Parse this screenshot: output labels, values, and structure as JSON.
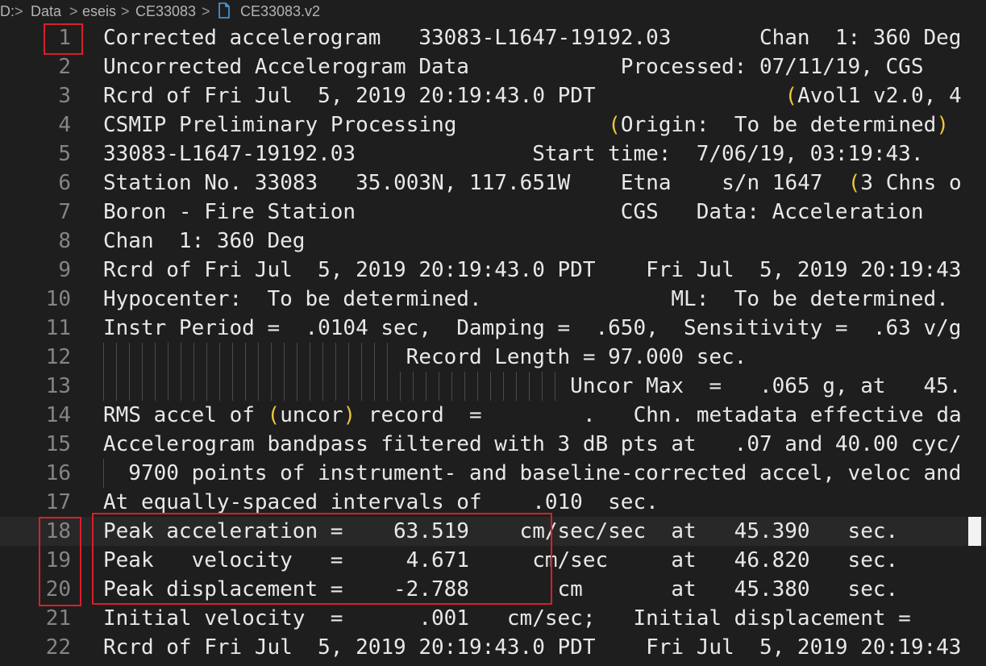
{
  "breadcrumb": {
    "root": "D:",
    "items": [
      "Data",
      "eseis",
      "CE33083",
      "CE33083.v2"
    ]
  },
  "editor": {
    "lines": [
      {
        "num": "1",
        "text": "Corrected accelerogram   33083-L1647-19192.03       Chan  1: 360 Deg"
      },
      {
        "num": "2",
        "text": "Uncorrected Accelerogram Data            Processed: 07/11/19, CGS"
      },
      {
        "num": "3",
        "text": "Rcrd of Fri Jul  5, 2019 20:19:43.0 PDT               (Avol1 v2.0, 4"
      },
      {
        "num": "4",
        "text": "CSMIP Preliminary Processing            (Origin:  To be determined)"
      },
      {
        "num": "5",
        "text": "33083-L1647-19192.03              Start time:  7/06/19, 03:19:43."
      },
      {
        "num": "6",
        "text": "Station No. 33083   35.003N, 117.651W    Etna    s/n 1647  (3 Chns o"
      },
      {
        "num": "7",
        "text": "Boron - Fire Station                     CGS   Data: Acceleration"
      },
      {
        "num": "8",
        "text": "Chan  1: 360 Deg"
      },
      {
        "num": "9",
        "text": "Rcrd of Fri Jul  5, 2019 20:19:43.0 PDT    Fri Jul  5, 2019 20:19:43"
      },
      {
        "num": "10",
        "text": "Hypocenter:  To be determined.               ML:  To be determined."
      },
      {
        "num": "11",
        "text": "Instr Period =  .0104 sec,  Damping =  .650,  Sensitivity =  .63 v/g"
      },
      {
        "num": "12",
        "text": "                        Record Length = 97.000 sec."
      },
      {
        "num": "13",
        "text": "                                     Uncor Max  =   .065 g, at   45."
      },
      {
        "num": "14",
        "text": "RMS accel of (uncor) record  =        .   Chn. metadata effective da"
      },
      {
        "num": "15",
        "text": "Accelerogram bandpass filtered with 3 dB pts at   .07 and 40.00 cyc/"
      },
      {
        "num": "16",
        "text": "  9700 points of instrument- and baseline-corrected accel, veloc and"
      },
      {
        "num": "17",
        "text": "At equally-spaced intervals of    .010  sec."
      },
      {
        "num": "18",
        "text": "Peak acceleration =    63.519    cm/sec/sec  at   45.390   sec."
      },
      {
        "num": "19",
        "text": "Peak   velocity   =     4.671     cm/sec     at   46.820   sec."
      },
      {
        "num": "20",
        "text": "Peak displacement =    -2.788       cm       at   45.380   sec."
      },
      {
        "num": "21",
        "text": "Initial velocity  =      .001   cm/sec;   Initial displacement ="
      },
      {
        "num": "22",
        "text": "Rcrd of Fri Jul  5, 2019 20:19:43.0 PDT    Fri Jul  5, 2019 20:19:43"
      }
    ]
  },
  "colors": {
    "background": "#1e1e1e",
    "text": "#e8e8e8",
    "line_number": "#858585",
    "bracket": "#f0c53a",
    "annotation_box": "#d8202a",
    "current_line": "#282828"
  },
  "icons": {
    "breadcrumb_separator": "chevron-right-icon",
    "file": "file-icon"
  }
}
